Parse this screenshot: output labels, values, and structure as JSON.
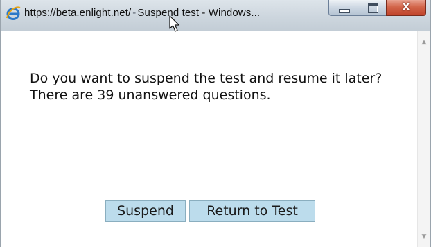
{
  "window": {
    "url": "https://beta.enlight.net/",
    "separator": "-",
    "title": "Suspend test - Windows...",
    "close_glyph": "X"
  },
  "icons": {
    "app": "internet-explorer-icon",
    "cursor": "mouse-pointer-icon",
    "minimize": "minimize-icon",
    "maximize": "maximize-icon",
    "close": "close-icon",
    "scroll_up": "scroll-up-arrow-icon",
    "scroll_down": "scroll-down-arrow-icon"
  },
  "dialog": {
    "message_line1": "Do you want to suspend the test and resume it later?",
    "message_line2": "There are 39 unanswered questions.",
    "suspend_label": "Suspend",
    "return_label": "Return to Test"
  },
  "colors": {
    "button_bg": "#bcdcec",
    "close_button": "#c0432a",
    "titlebar": "#cdd6de"
  }
}
